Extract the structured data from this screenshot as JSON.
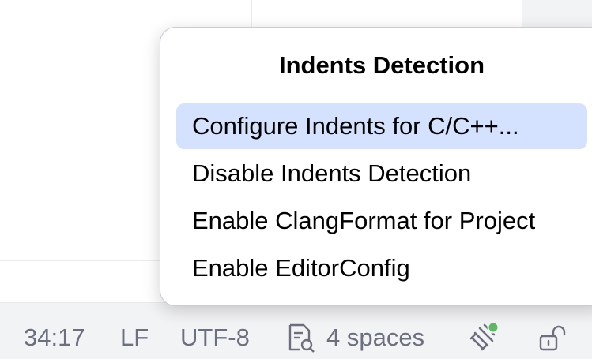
{
  "status_bar": {
    "caret_position": "34:17",
    "line_separator": "LF",
    "encoding": "UTF-8",
    "indent": "4 spaces",
    "icons": {
      "indent_icon": "document-search-icon",
      "ai_icon": "ai-assistant-icon",
      "ai_status_color": "#5fb865",
      "lock_icon": "unlock-icon"
    }
  },
  "popup": {
    "title": "Indents Detection",
    "items": [
      {
        "label": "Configure Indents for C/C++...",
        "selected": true
      },
      {
        "label": "Disable Indents Detection",
        "selected": false
      },
      {
        "label": "Enable ClangFormat for Project",
        "selected": false
      },
      {
        "label": "Enable EditorConfig",
        "selected": false
      }
    ]
  },
  "colors": {
    "selection": "#d4e2ff",
    "status_text": "#6c707e",
    "status_background": "#f2f3f5"
  }
}
